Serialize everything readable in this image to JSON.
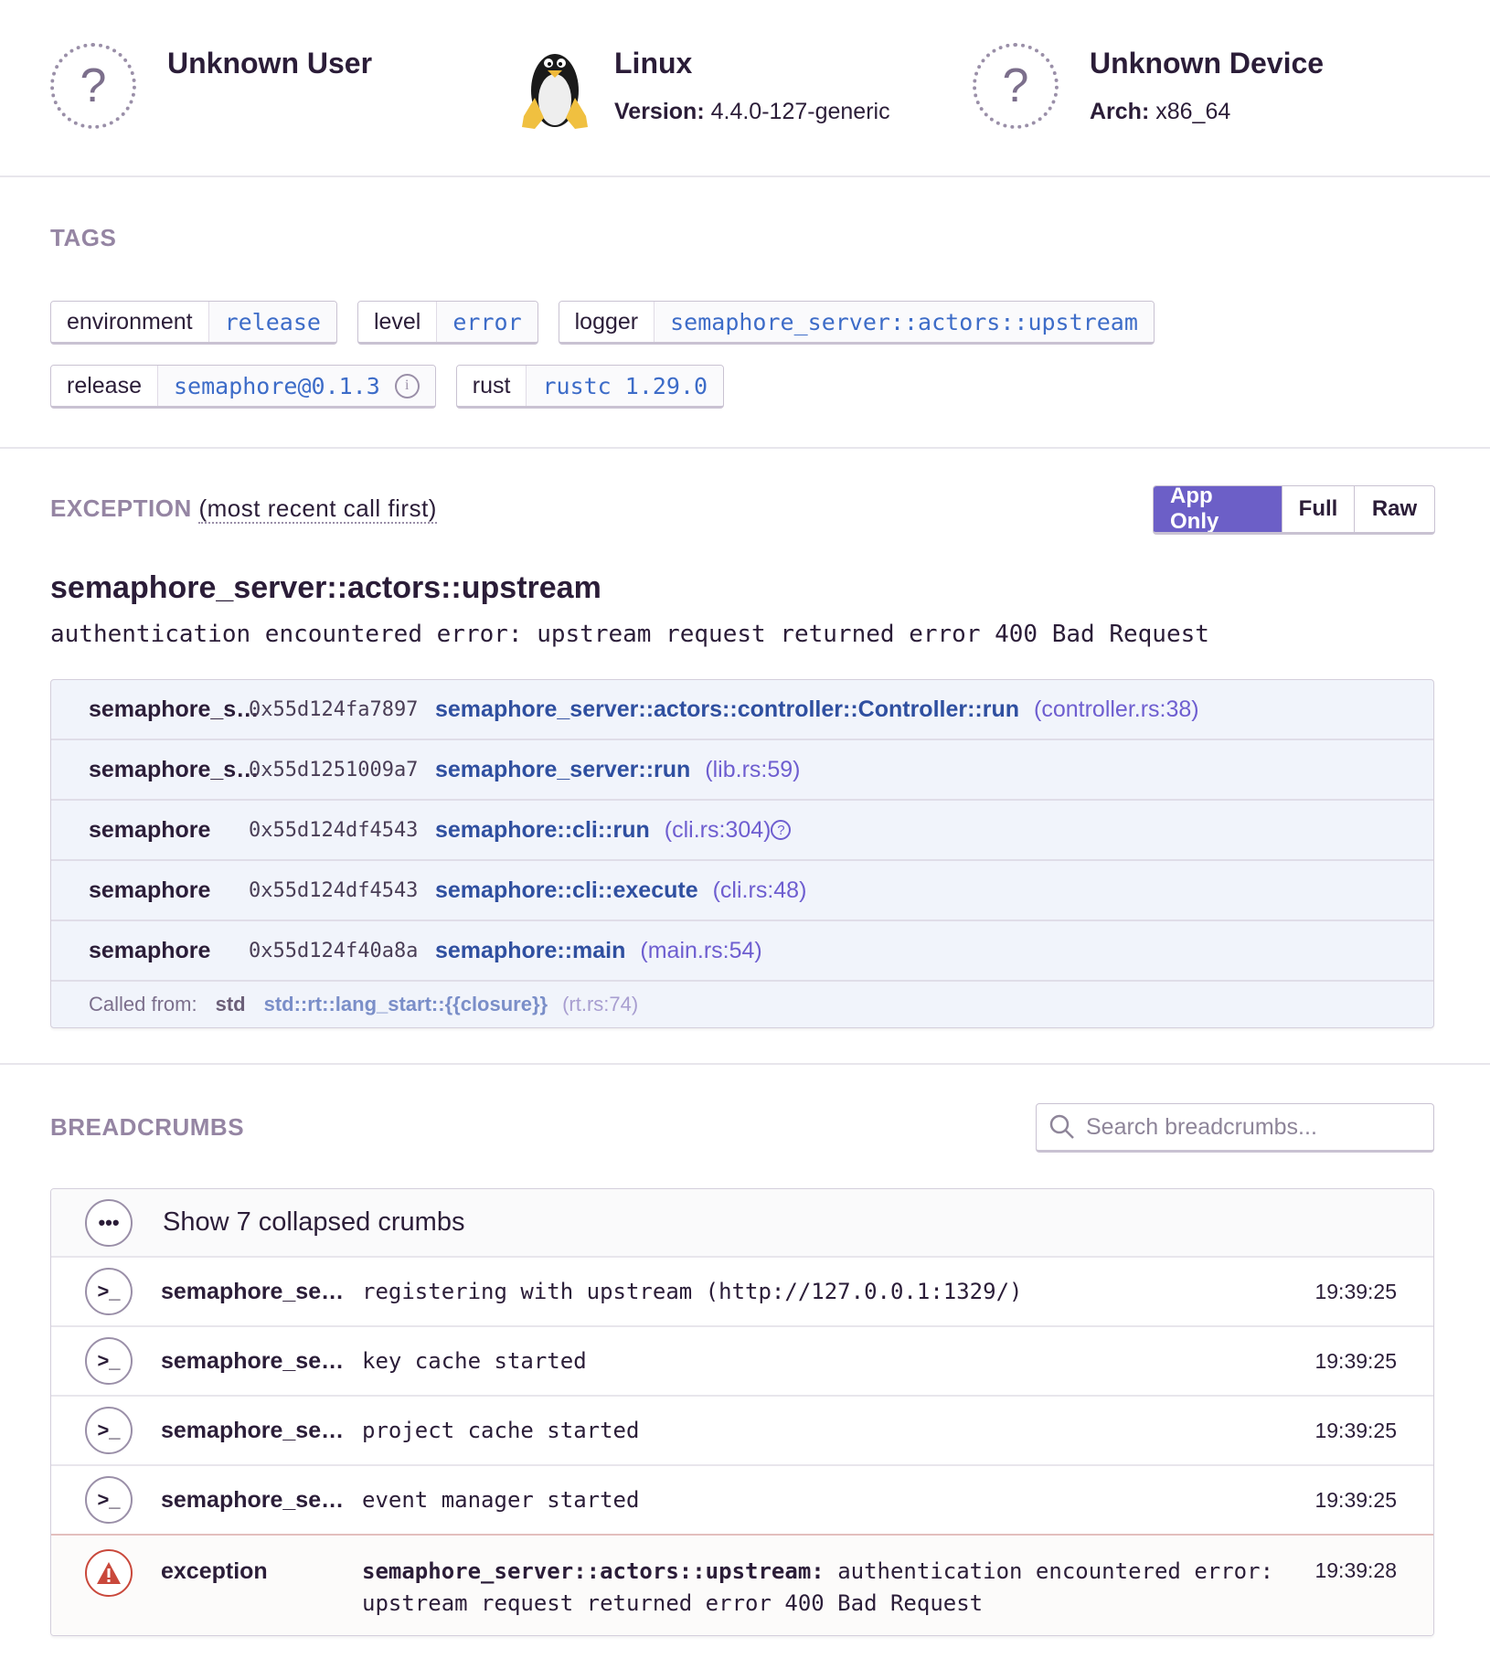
{
  "context": {
    "user": {
      "title": "Unknown User",
      "icon": "question-circle-icon"
    },
    "os": {
      "title": "Linux",
      "version_label": "Version:",
      "version": "4.4.0-127-generic",
      "icon": "tux-penguin-icon"
    },
    "device": {
      "title": "Unknown Device",
      "arch_label": "Arch:",
      "arch": "x86_64",
      "icon": "question-circle-icon"
    }
  },
  "tags": {
    "label": "TAGS",
    "items": [
      {
        "key": "environment",
        "value": "release"
      },
      {
        "key": "level",
        "value": "error"
      },
      {
        "key": "logger",
        "value": "semaphore_server::actors::upstream"
      },
      {
        "key": "release",
        "value": "semaphore@0.1.3",
        "info": "i"
      },
      {
        "key": "rust",
        "value": "rustc 1.29.0"
      }
    ]
  },
  "exception": {
    "label": "EXCEPTION",
    "sublabel": "(most recent call first)",
    "buttons": [
      "App Only",
      "Full",
      "Raw"
    ],
    "active_button": "App Only",
    "type": "semaphore_server::actors::upstream",
    "message": "authentication encountered error: upstream request returned error 400 Bad Request",
    "frames": [
      {
        "package": "semaphore_s…",
        "address": "0x55d124fa7897",
        "function": "semaphore_server::actors::controller::Controller::run",
        "location": "(controller.rs:38)"
      },
      {
        "package": "semaphore_s…",
        "address": "0x55d1251009a7",
        "function": "semaphore_server::run",
        "location": "(lib.rs:59)"
      },
      {
        "package": "semaphore",
        "address": "0x55d124df4543",
        "function": "semaphore::cli::run",
        "location": "(cli.rs:304)",
        "help": "?"
      },
      {
        "package": "semaphore",
        "address": "0x55d124df4543",
        "function": "semaphore::cli::execute",
        "location": "(cli.rs:48)"
      },
      {
        "package": "semaphore",
        "address": "0x55d124f40a8a",
        "function": "semaphore::main",
        "location": "(main.rs:54)"
      }
    ],
    "called_from": {
      "label": "Called from:",
      "package": "std",
      "function": "std::rt::lang_start::{{closure}}",
      "location": "(rt.rs:74)"
    }
  },
  "breadcrumbs": {
    "label": "BREADCRUMBS",
    "search_placeholder": "Search breadcrumbs...",
    "collapsed": "Show 7 collapsed crumbs",
    "items": [
      {
        "category": "semaphore_se…",
        "message": "registering with upstream (http://127.0.0.1:1329/)",
        "time": "19:39:25"
      },
      {
        "category": "semaphore_se…",
        "message": "key cache started",
        "time": "19:39:25"
      },
      {
        "category": "semaphore_se…",
        "message": "project cache started",
        "time": "19:39:25"
      },
      {
        "category": "semaphore_se…",
        "message": "event manager started",
        "time": "19:39:25"
      }
    ],
    "exception_item": {
      "category": "exception",
      "message_prefix": "semaphore_server::actors::upstream:",
      "message": "authentication encountered error: upstream request returned error 400 Bad Request",
      "time": "19:39:28"
    }
  },
  "colors": {
    "accent": "#6c5fc7",
    "link": "#2f4fa0",
    "tag_value": "#3d6cc8",
    "error": "#c9483b",
    "section_label": "#9585a3"
  }
}
